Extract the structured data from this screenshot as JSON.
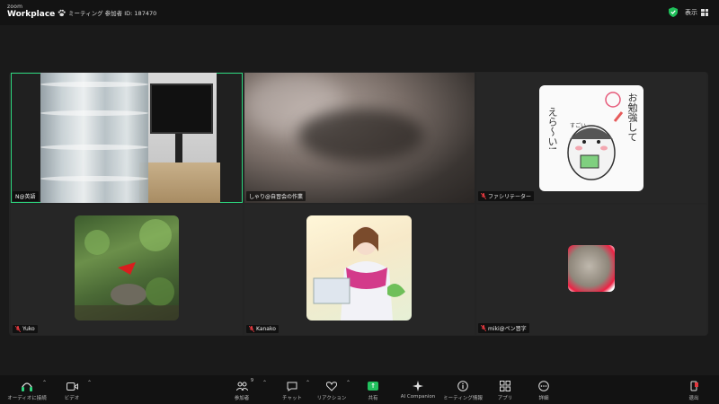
{
  "topbar": {
    "logo_top": "zoom",
    "logo_bottom": "Workplace",
    "meeting_info": "ミーティング 参加者 ID: 187470",
    "view_label": "表示"
  },
  "tiles": [
    {
      "name": "N@英語",
      "active": true,
      "muted": false
    },
    {
      "name": "しゃり@自習会の作業",
      "active": false,
      "muted": false
    },
    {
      "name": "ファシリテーター",
      "active": false,
      "muted": true,
      "avatar_text_right": "お勉強して",
      "avatar_text_left": "えら〜い!",
      "avatar_bubble": "すごい"
    },
    {
      "name": "Yuko",
      "active": false,
      "muted": true
    },
    {
      "name": "Kanako",
      "active": false,
      "muted": true
    },
    {
      "name": "miki@ペン習字",
      "active": false,
      "muted": true
    }
  ],
  "toolbar": {
    "audio": "オーディオに接続",
    "video": "ビデオ",
    "participants": "参加者",
    "participants_count": "9",
    "chat": "チャット",
    "reactions": "リアクション",
    "share": "共有",
    "ai": "AI Companion",
    "info": "ミーティング情報",
    "apps": "アプリ",
    "more": "詳細",
    "leave": "退出"
  },
  "colors": {
    "active_border": "#2dd67e",
    "share_green": "#22c15e",
    "muted_red": "#e0383e",
    "shield_green": "#1fbf5a"
  }
}
